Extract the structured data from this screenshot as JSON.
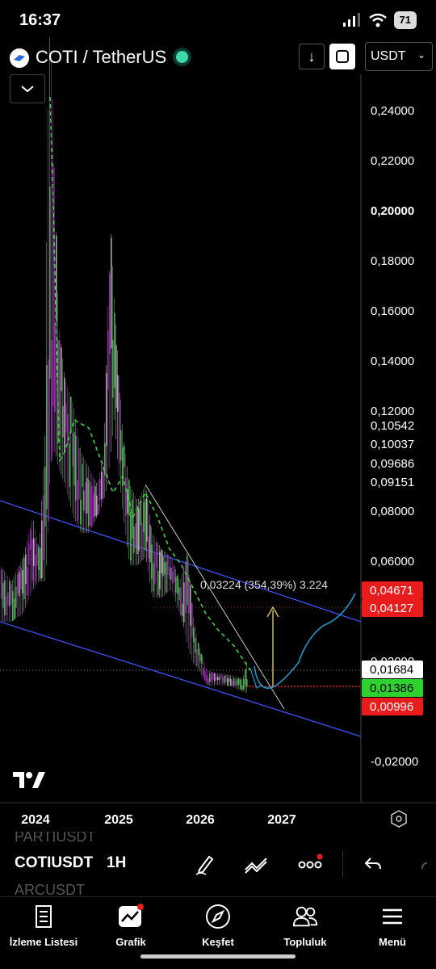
{
  "status_bar": {
    "time": "16:37",
    "battery": "71"
  },
  "header": {
    "pair_title": "COTI / TetherUS",
    "currency": "USDT",
    "down_icon": "arrow-down-icon",
    "expand_icon": "expand-icon"
  },
  "chart": {
    "y_axis_labels": [
      "0,24000",
      "0,22000",
      "0,20000",
      "0,18000",
      "0,16000",
      "0,14000",
      "0,12000",
      "0,10542",
      "0,10037",
      "0,09686",
      "0,09151",
      "0,08000",
      "0,06000",
      "0,02000",
      "-0,02000"
    ],
    "price_tags": {
      "upper_red": "0,04671",
      "lower_red": "0,04127",
      "white": "0,01684",
      "green": "0,01386",
      "red_bottom": "0,00996"
    },
    "x_axis_labels": [
      "2024",
      "2025",
      "2026",
      "2027"
    ],
    "measure_label": "0,03224 (354,39%) 3.224",
    "colors": {
      "up_candle": "#4caf50",
      "down_candle": "#9c27b0",
      "neutral_candle": "#aaaaaa",
      "channel": "#3f51f5",
      "ma_line": "#3ecf3e",
      "projection": "#2196c8",
      "red_tag": "#e81c1c",
      "green_tag": "#2fd12f"
    }
  },
  "toolbar": {
    "ghost_top": "PARTIUSDT",
    "symbol": "COTIUSDT",
    "interval": "1H",
    "ghost_bottom": "ARCUSDT"
  },
  "nav": {
    "items": [
      {
        "label": "İzleme Listesi",
        "icon": "watchlist-icon"
      },
      {
        "label": "Grafik",
        "icon": "chart-icon"
      },
      {
        "label": "Keşfet",
        "icon": "compass-icon"
      },
      {
        "label": "Topluluk",
        "icon": "community-icon"
      },
      {
        "label": "Menü",
        "icon": "menu-icon"
      }
    ]
  }
}
